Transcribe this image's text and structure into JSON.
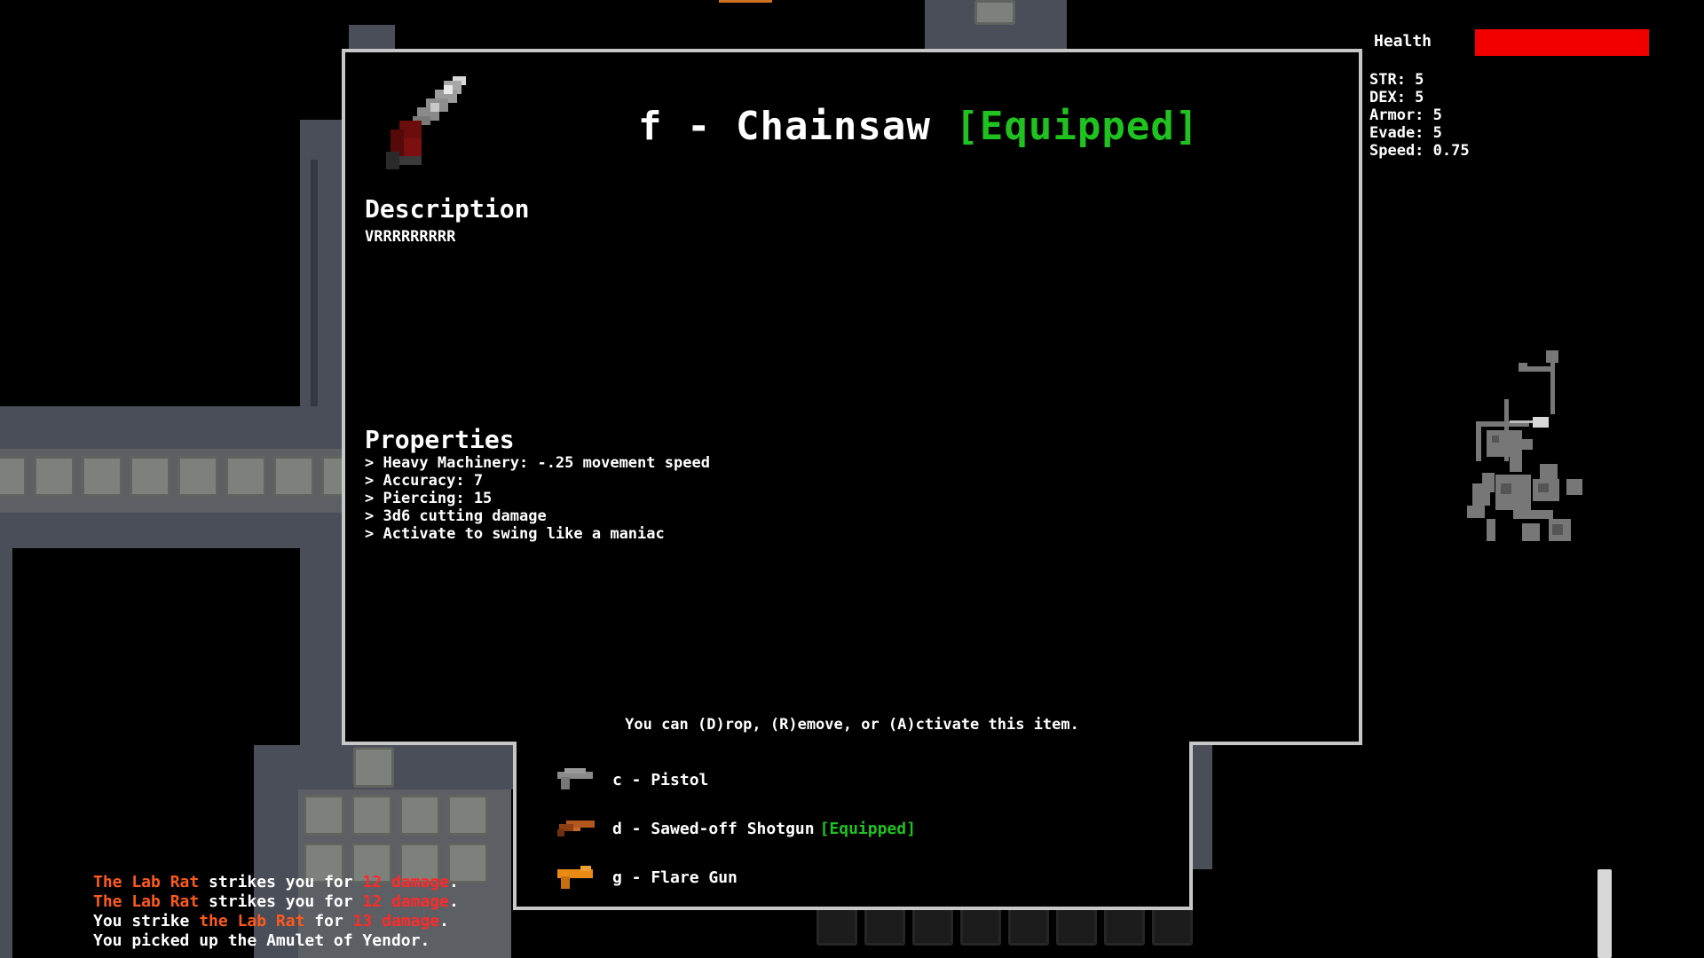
{
  "item": {
    "title": "f - Chainsaw",
    "equipped_tag": "[Equipped]",
    "icon": "chainsaw-icon",
    "description_heading": "Description",
    "description": "VRRRRRRRRR",
    "properties_heading": "Properties",
    "properties": [
      "> Heavy Machinery: -.25 movement speed",
      "> Accuracy: 7",
      "> Piercing: 15",
      "> 3d6 cutting damage",
      "> Activate to swing like a maniac"
    ],
    "help": "You can (D)rop, (R)emove, or (A)ctivate this item."
  },
  "inventory": [
    {
      "label": "c - Pistol",
      "equipped": "",
      "icon": "pistol-icon",
      "color": "#8a8a8a"
    },
    {
      "label": "d - Sawed-off Shotgun",
      "equipped": "[Equipped]",
      "icon": "shotgun-icon",
      "color": "#b2571e"
    },
    {
      "label": "g - Flare Gun",
      "equipped": "",
      "icon": "flare-gun-icon",
      "color": "#e88a14"
    }
  ],
  "hud": {
    "health_label": "Health",
    "health_fraction": 1.0,
    "health_color": "#f20000",
    "stats": [
      "STR: 5",
      "DEX: 5",
      "Armor: 5",
      "Evade: 5",
      "Speed: 0.75"
    ]
  },
  "log": [
    [
      {
        "t": "The Lab Rat",
        "c": "hl"
      },
      {
        "t": " strikes you for "
      },
      {
        "t": "12 damage",
        "c": "dm"
      },
      {
        "t": "."
      }
    ],
    [
      {
        "t": "The Lab Rat",
        "c": "hl"
      },
      {
        "t": " strikes you for "
      },
      {
        "t": "12 damage",
        "c": "dm"
      },
      {
        "t": "."
      }
    ],
    [
      {
        "t": "You strike "
      },
      {
        "t": "the Lab Rat",
        "c": "hl"
      },
      {
        "t": " for "
      },
      {
        "t": "13 damage",
        "c": "dm"
      },
      {
        "t": "."
      }
    ],
    [
      {
        "t": "You picked up the Amulet of Yendor."
      }
    ]
  ],
  "colors": {
    "equipped": "#1fc21f",
    "name_highlight": "#ff5a1e",
    "damage": "#ff2a2a"
  }
}
